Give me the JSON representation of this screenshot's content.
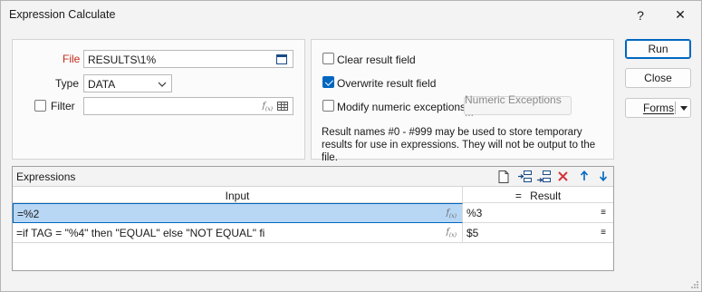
{
  "window": {
    "title": "Expression Calculate",
    "help_glyph": "?",
    "close_glyph": "✕"
  },
  "file_panel": {
    "file_label": "File",
    "file_value": "RESULTS\\1%",
    "type_label": "Type",
    "type_value": "DATA",
    "filter_label": "Filter",
    "filter_value": "",
    "filter_checked": false
  },
  "options_panel": {
    "clear_result_label": "Clear result field",
    "clear_result_checked": false,
    "overwrite_result_label": "Overwrite result field",
    "overwrite_result_checked": true,
    "modify_numeric_label": "Modify numeric exceptions",
    "modify_numeric_checked": false,
    "numeric_exceptions_button": "Numeric Exceptions ...",
    "note": "Result names #0 - #999 may be used to store temporary results for use in expressions. They will not be output to the file."
  },
  "buttons": {
    "run": "Run",
    "close": "Close",
    "forms": "Forms"
  },
  "expressions": {
    "title": "Expressions",
    "columns": {
      "input": "Input",
      "result_prefix": "=",
      "result": "Result"
    },
    "rows": [
      {
        "input": "=%2",
        "result": "%3",
        "selected": true
      },
      {
        "input": "=if TAG = \"%4\" then \"EQUAL\" else \"NOT EQUAL\" fi",
        "result": "$5",
        "selected": false
      }
    ]
  },
  "colors": {
    "accent": "#0067c0",
    "selected_row": "#b8d7f5",
    "delete_icon": "#d13438",
    "arrow_icon": "#0067c0"
  }
}
